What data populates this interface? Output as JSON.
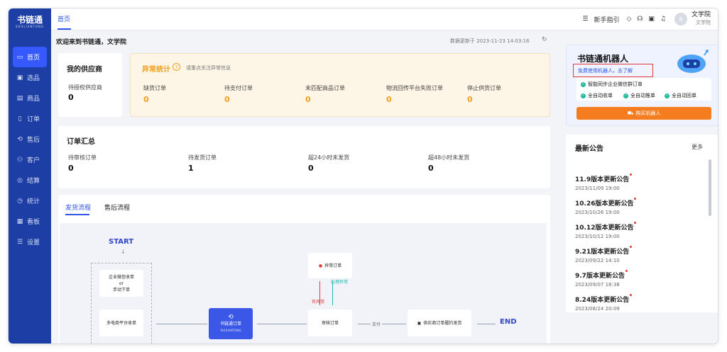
{
  "sidebar": {
    "logo": "书链通",
    "logo_sub": "SHULIANTONG",
    "items": [
      {
        "label": "首页",
        "icon": "monitor-icon",
        "glyph": "▭"
      },
      {
        "label": "选品",
        "icon": "box-icon",
        "glyph": "▣"
      },
      {
        "label": "商品",
        "icon": "goods-icon",
        "glyph": "▤"
      },
      {
        "label": "订单",
        "icon": "order-icon",
        "glyph": "▯"
      },
      {
        "label": "售后",
        "icon": "service-icon",
        "glyph": "⟲"
      },
      {
        "label": "客户",
        "icon": "customer-icon",
        "glyph": "⚇"
      },
      {
        "label": "结算",
        "icon": "settle-icon",
        "glyph": "◎"
      },
      {
        "label": "统计",
        "icon": "clock-icon",
        "glyph": "◷"
      },
      {
        "label": "看板",
        "icon": "board-icon",
        "glyph": "▦"
      },
      {
        "label": "设置",
        "icon": "settings-icon",
        "glyph": "☰"
      }
    ]
  },
  "topbar": {
    "tab": "首页",
    "guide": "新手指引",
    "user_name": "文学院",
    "user_sub": "文学院",
    "avatar_glyph": "8"
  },
  "welcome": "欢迎来到书链通，文学院",
  "updated": "数据更新于 2023-11-23 14:03:16",
  "supplier": {
    "title": "我的供应商",
    "label": "待授权供应商",
    "value": "0"
  },
  "abnormal": {
    "title": "异常统计",
    "hint": "请重点关注异常信息",
    "items": [
      {
        "label": "缺货订单",
        "value": "0"
      },
      {
        "label": "待支付订单",
        "value": "0"
      },
      {
        "label": "未匹配商品订单",
        "value": "0"
      },
      {
        "label": "物流回传平台失败订单",
        "value": "0"
      },
      {
        "label": "停止供货订单",
        "value": "0"
      }
    ]
  },
  "orders": {
    "title": "订单汇总",
    "items": [
      {
        "label": "待审核订单",
        "value": "0"
      },
      {
        "label": "待发货订单",
        "value": "1"
      },
      {
        "label": "超24小时未发货",
        "value": "0"
      },
      {
        "label": "超48小时未发货",
        "value": "0"
      }
    ]
  },
  "flow": {
    "tabs": [
      "发货流程",
      "售后流程"
    ],
    "start": "START",
    "end": "END",
    "box_wecom_1": "企业微信收单",
    "box_wecom_2": "or",
    "box_wecom_3": "手动下单",
    "box_multi": "多电商平台收单",
    "box_core": "书链通订单",
    "box_core_sub": "SHULIANTONG",
    "box_abnormal": "异常订单",
    "box_review": "审核订单",
    "box_supplier": "供应商订单履约发货",
    "label_has_abnormal": "有异常",
    "label_handle": "处理异常",
    "label_pay": "支付"
  },
  "robot": {
    "title": "书链通机器人",
    "link": "免费使用机器人，去了解",
    "feature_main": "智能同步企业微信群订单",
    "features": [
      "全自动收单",
      "全自动推单",
      "全自动回单"
    ],
    "buy": "购买机器人"
  },
  "notices": {
    "title": "最新公告",
    "more": "更多",
    "items": [
      {
        "title": "11.9版本更新公告",
        "date": "2023/11/09 19:00"
      },
      {
        "title": "10.26版本更新公告",
        "date": "2023/10/26 19:00"
      },
      {
        "title": "10.12版本更新公告",
        "date": "2023/10/12 19:00"
      },
      {
        "title": "9.21版本更新公告",
        "date": "2023/09/22 14:10"
      },
      {
        "title": "9.7版本更新公告",
        "date": "2023/09/07 18:38"
      },
      {
        "title": "8.24版本更新公告",
        "date": "2023/08/24 20:09"
      }
    ]
  },
  "colors": {
    "sidebar": "#1d3fa5",
    "accent": "#2f55e8",
    "warning": "#f0a020",
    "buy": "#f57c1f"
  }
}
